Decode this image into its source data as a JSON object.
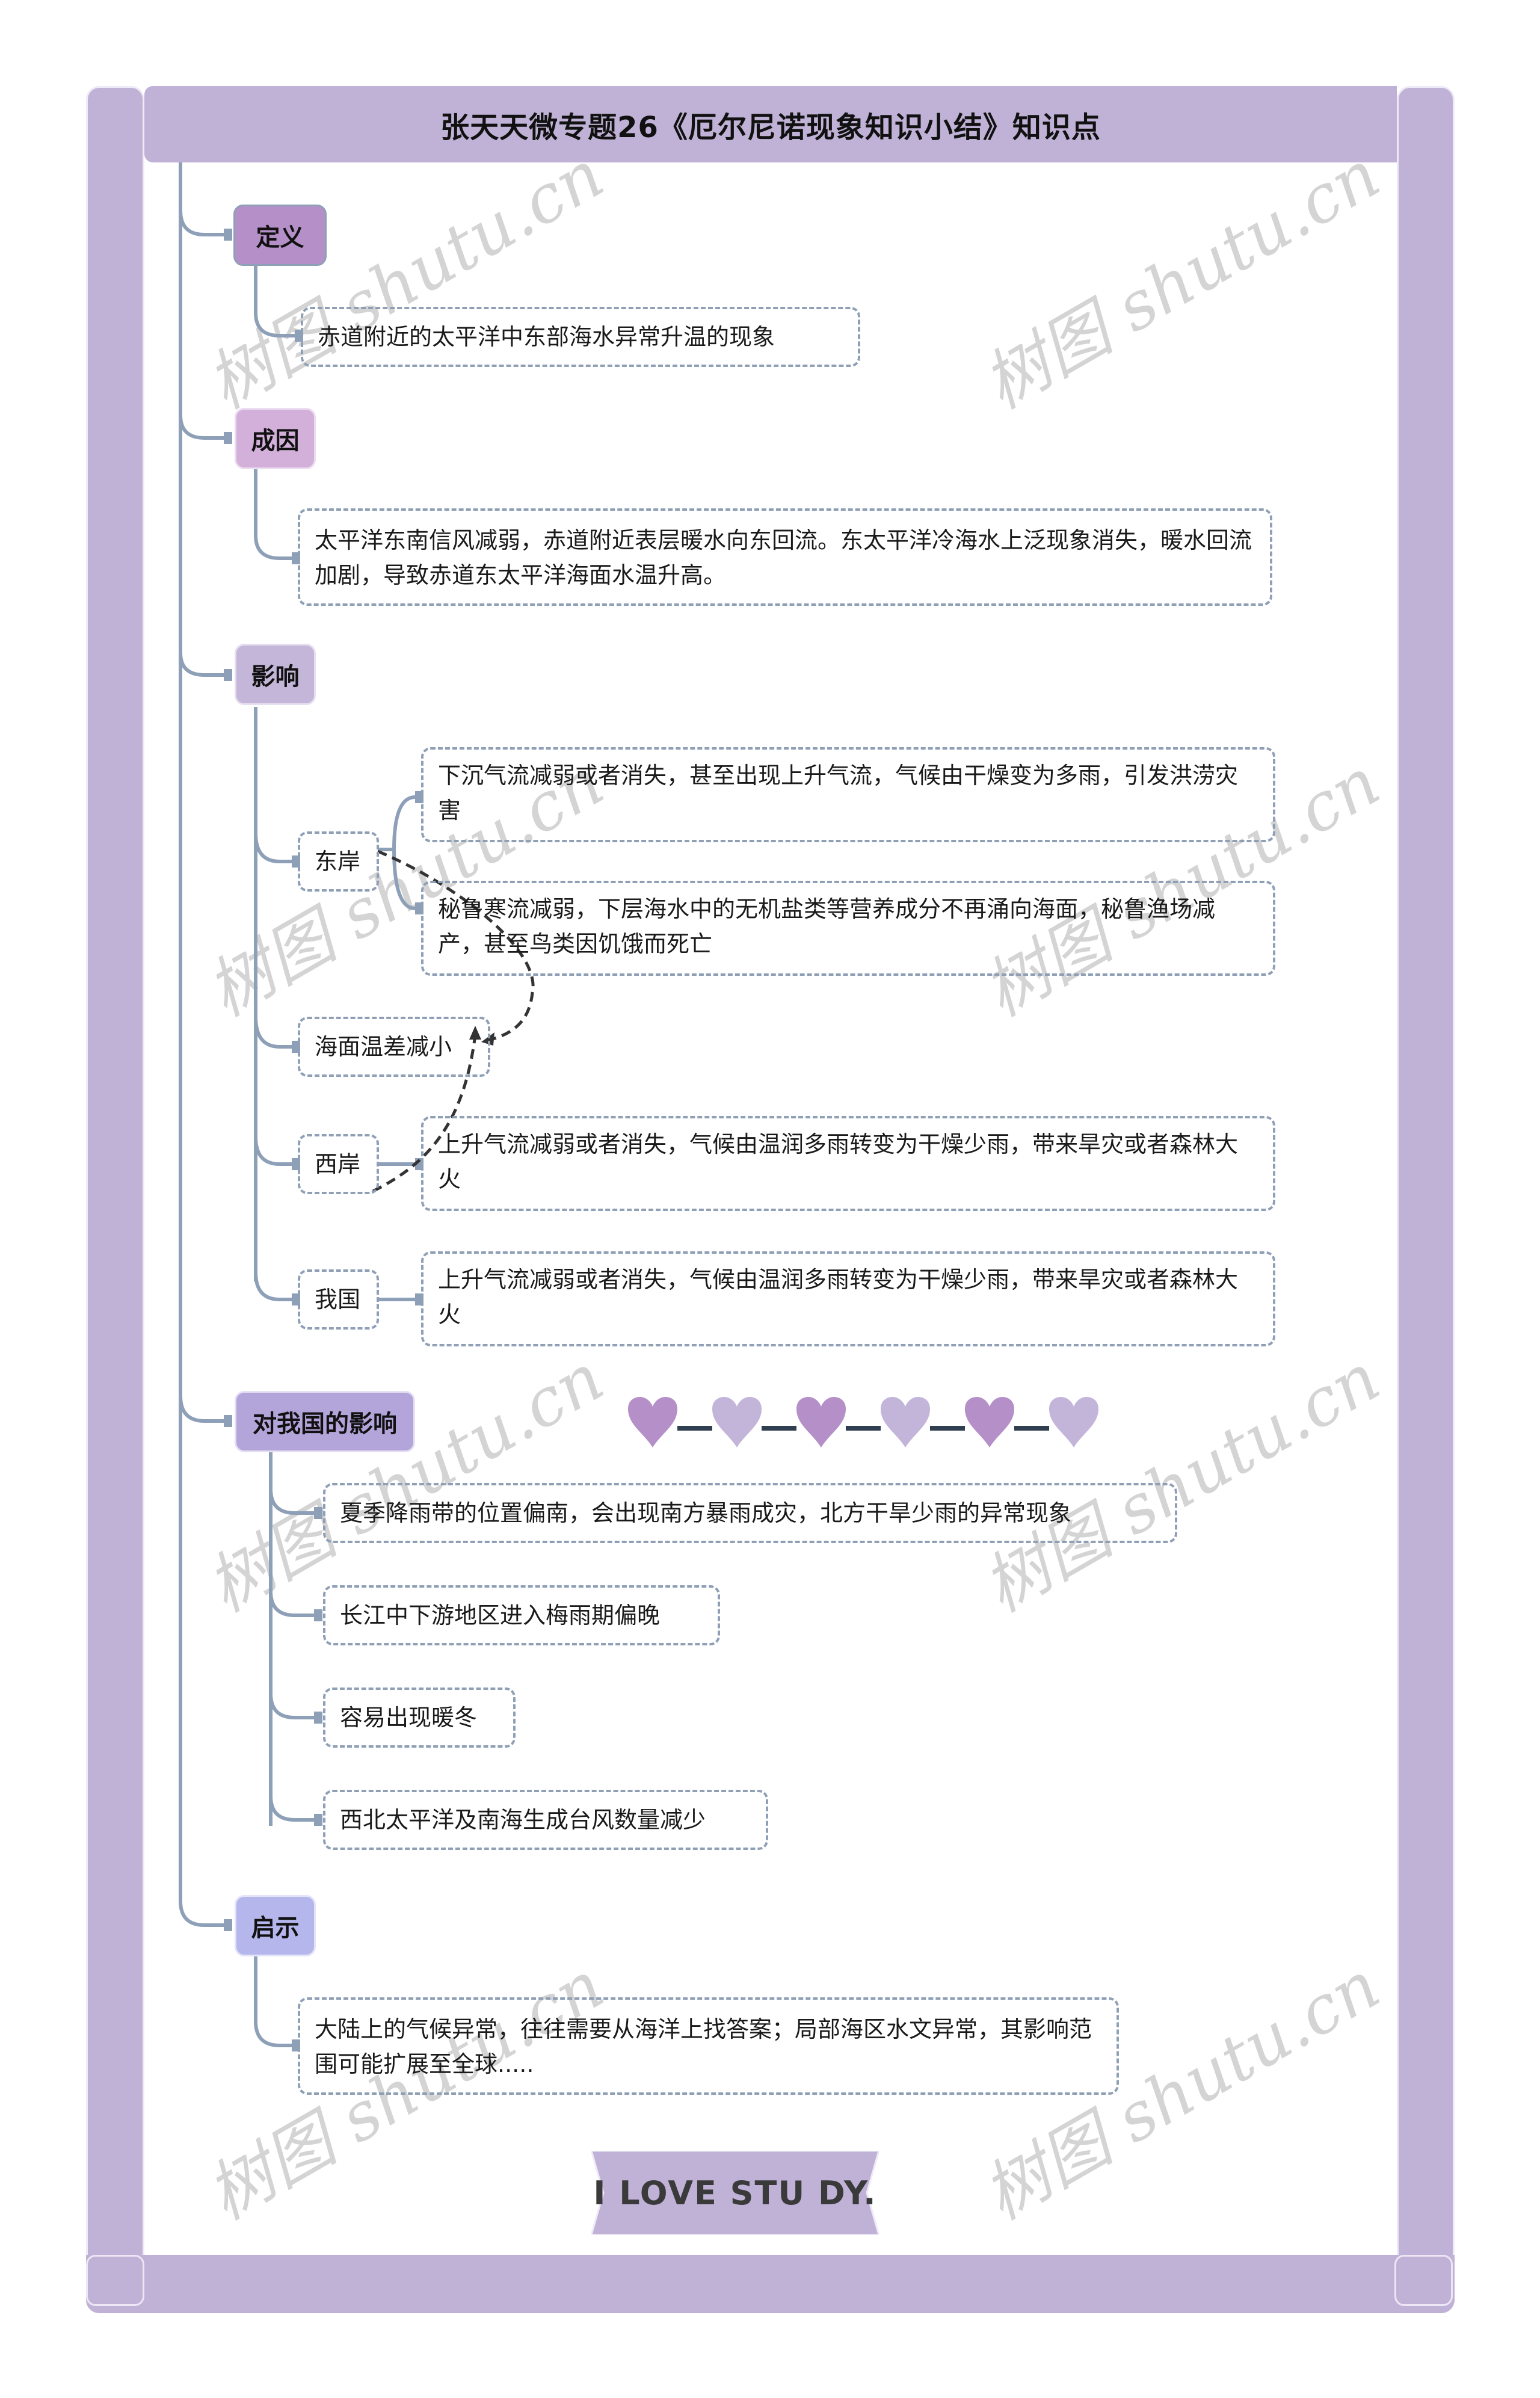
{
  "title": "张天天微专题26《厄尔尼诺现象知识小结》知识点",
  "watermark": "树图 shutu.cn",
  "colors": {
    "frame": "#c0b2d6",
    "line": "#8ea0b8",
    "definition": "#b58fc8",
    "cause": "#d2b0da",
    "effect": "#c4b6d9",
    "china_effect": "#b3a4da",
    "insight": "#b5b6ec",
    "heart_dark": "#b48fc8",
    "heart_light": "#c3b4da"
  },
  "sections": {
    "definition": {
      "label": "定义",
      "items": [
        "赤道附近的太平洋中东部海水异常升温的现象"
      ]
    },
    "cause": {
      "label": "成因",
      "items": [
        "太平洋东南信风减弱，赤道附近表层暖水向东回流。东太平洋冷海水上泛现象消失，暖水回流加剧，导致赤道东太平洋海面水温升高。"
      ]
    },
    "effect": {
      "label": "影响",
      "children": [
        {
          "label": "东岸",
          "items": [
            "下沉气流减弱或者消失，甚至出现上升气流，气候由干燥变为多雨，引发洪涝灾害",
            "秘鲁寒流减弱，下层海水中的无机盐类等营养成分不再涌向海面，秘鲁渔场减产，甚至鸟类因饥饿而死亡"
          ]
        },
        {
          "label": "海面温差减小"
        },
        {
          "label": "西岸",
          "items": [
            "上升气流减弱或者消失，气候由温润多雨转变为干燥少雨，带来旱灾或者森林大火"
          ]
        },
        {
          "label": "我国",
          "items": [
            "上升气流减弱或者消失，气候由温润多雨转变为干燥少雨，带来旱灾或者森林大火"
          ]
        }
      ]
    },
    "china_effect": {
      "label": "对我国的影响",
      "items": [
        "夏季降雨带的位置偏南，会出现南方暴雨成灾，北方干旱少雨的异常现象",
        "长江中下游地区进入梅雨期偏晚",
        "容易出现暖冬",
        "西北太平洋及南海生成台风数量减少"
      ]
    },
    "insight": {
      "label": "启示",
      "items": [
        "大陆上的气候异常，往往需要从海洋上找答案；局部海区水文异常，其影响范围可能扩展至全球....."
      ]
    }
  },
  "hearts": [
    "dark",
    "light",
    "dark",
    "light",
    "dark",
    "light"
  ],
  "banner": "I LOVE STU DY."
}
